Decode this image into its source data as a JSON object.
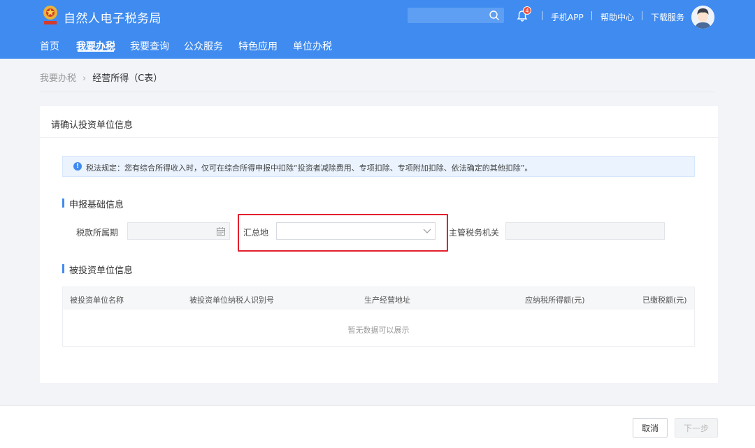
{
  "header": {
    "app_title": "自然人电子税务局",
    "search_placeholder": "",
    "notification_count": "4",
    "links": [
      "手机APP",
      "帮助中心",
      "下载服务"
    ]
  },
  "nav": {
    "items": [
      "首页",
      "我要办税",
      "我要查询",
      "公众服务",
      "特色应用",
      "单位办税"
    ],
    "active": "我要办税"
  },
  "breadcrumb": {
    "parent": "我要办税",
    "current": "经营所得（C表）"
  },
  "card": {
    "title": "请确认投资单位信息",
    "notice": "税法规定：您有综合所得收入时，仅可在综合所得申报中扣除“投资者减除费用、专项扣除、专项附加扣除、依法确定的其他扣除”。"
  },
  "basic_info": {
    "section_title": "申报基础信息",
    "period_label": "税款所属期",
    "period_value": "",
    "summary_place_label": "汇总地",
    "summary_place_value": "",
    "tax_authority_label": "主管税务机关",
    "tax_authority_value": ""
  },
  "investee": {
    "section_title": "被投资单位信息",
    "columns": [
      "被投资单位名称",
      "被投资单位纳税人识别号",
      "生产经营地址",
      "应纳税所得额(元)",
      "已缴税额(元)"
    ],
    "empty_text": "暂无数据可以展示"
  },
  "footer": {
    "cancel_label": "取消",
    "next_label": "下一步"
  },
  "colors": {
    "brand_blue": "#3f8bf0",
    "highlight_red": "#e3202d"
  }
}
